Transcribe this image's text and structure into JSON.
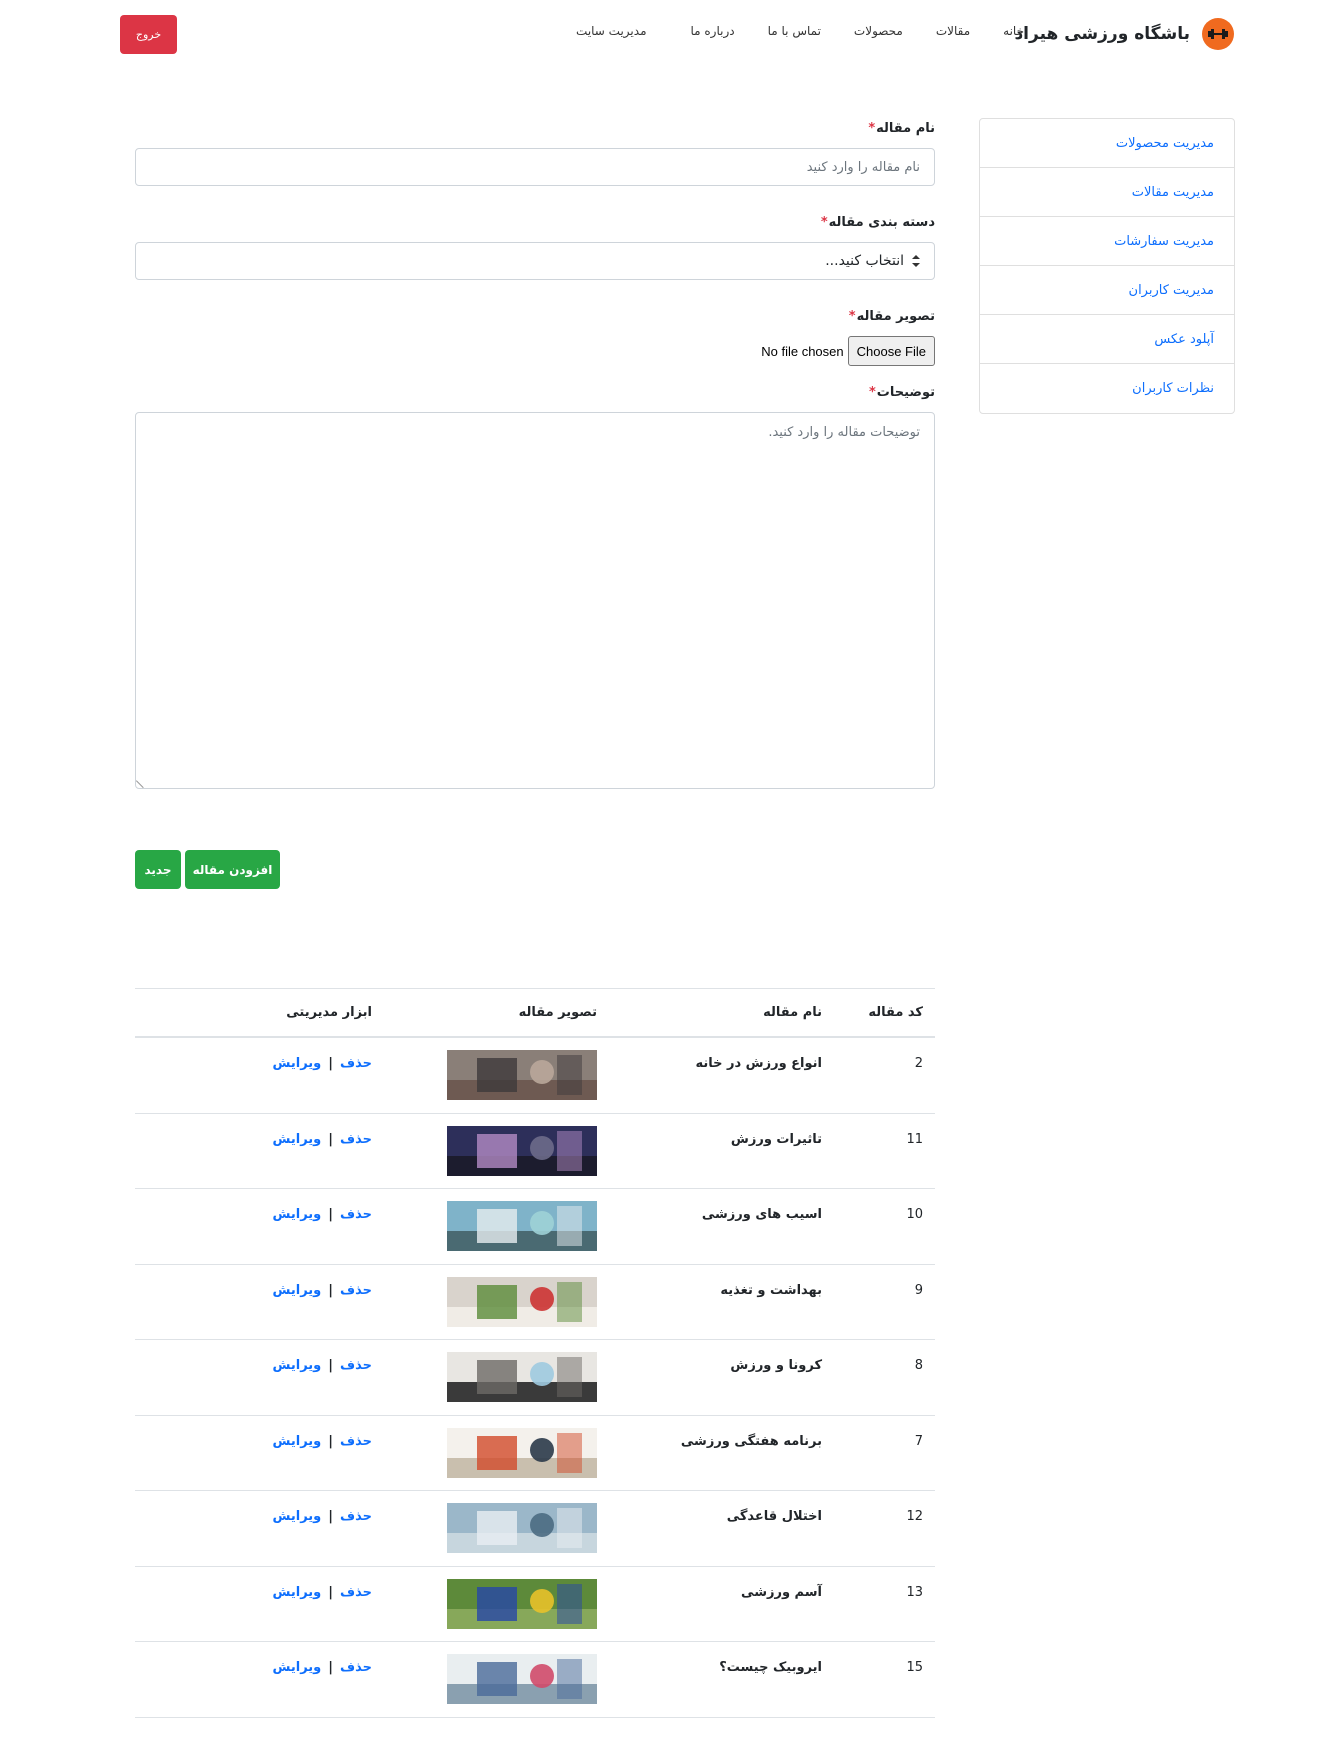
{
  "navbar": {
    "brand": "باشگاه ورزشی هیراد",
    "links": [
      "خانه",
      "مقالات",
      "محصولات",
      "تماس با ما",
      "درباره ما",
      "مدیریت سایت"
    ],
    "logout": "خروج",
    "logo_icon": "dumbbell-icon",
    "logo_color": "#f06a1f",
    "logout_color": "#dc3545"
  },
  "sidebar": {
    "items": [
      "مدیریت محصولات",
      "مدیریت مقالات",
      "مدیریت سفارشات",
      "مدیریت کاربران",
      "آپلود عکس",
      "نظرات کاربران"
    ],
    "link_color": "#0d6efd"
  },
  "form": {
    "name_label": "نام مقاله",
    "name_placeholder": "نام مقاله را وارد کنید",
    "category_label": "دسته بندی مقاله",
    "category_selected": "انتخاب کنید...",
    "image_label": "تصویر مقاله",
    "file_button": "Choose File",
    "file_status": "No file chosen",
    "description_label": "توضیحات",
    "description_placeholder": "توضیحات مقاله را وارد کنید.",
    "required_mark": "*",
    "submit_button": "افزودن مقاله",
    "new_button": "جدید",
    "button_color": "#28a745"
  },
  "table": {
    "headers": [
      "کد مقاله",
      "نام مقاله",
      "تصویر مقاله",
      "ابزار مدیریتی"
    ],
    "delete_label": "حذف",
    "separator": "|",
    "edit_label": "ویرایش",
    "rows": [
      {
        "code": "2",
        "name": "انواع ورزش در خانه"
      },
      {
        "code": "11",
        "name": "تاثیرات ورزش"
      },
      {
        "code": "10",
        "name": "اسیب های ورزشی"
      },
      {
        "code": "9",
        "name": "بهداشت و تغذیه"
      },
      {
        "code": "8",
        "name": "کرونا و ورزش"
      },
      {
        "code": "7",
        "name": "برنامه هفتگی ورزشی"
      },
      {
        "code": "12",
        "name": "اختلال قاعدگی"
      },
      {
        "code": "13",
        "name": "آسم ورزشی"
      },
      {
        "code": "15",
        "name": "ایروبیک چیست؟"
      }
    ]
  }
}
